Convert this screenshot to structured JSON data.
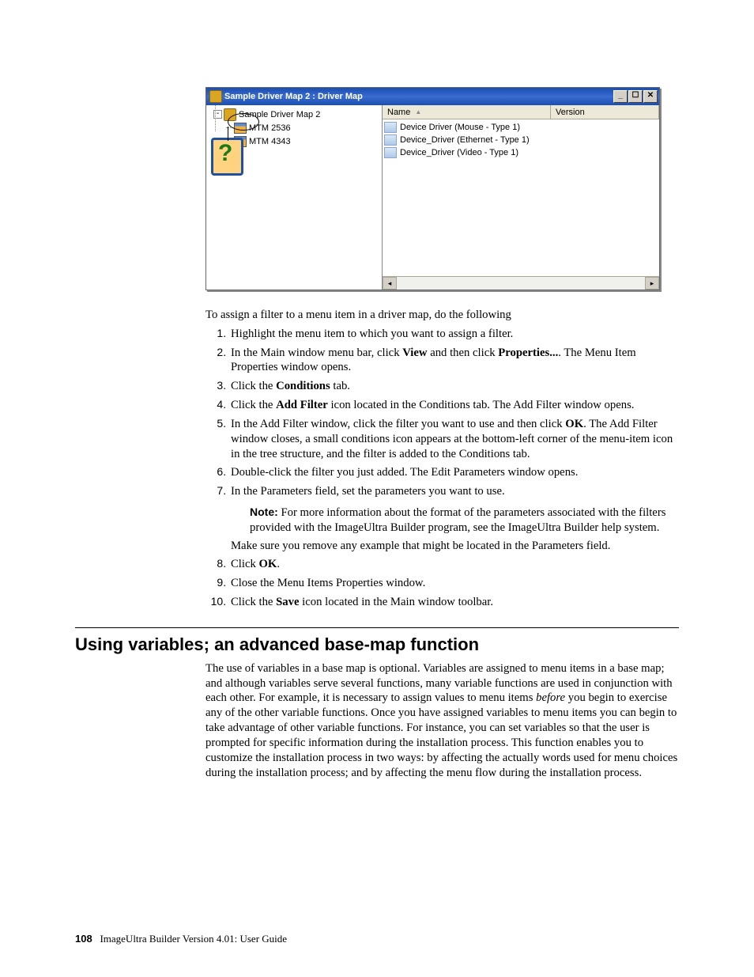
{
  "window": {
    "title": "Sample Driver Map 2 : Driver Map",
    "tree_root": "Sample Driver Map 2",
    "tree_children": [
      "MTM 2536",
      "MTM 4343"
    ],
    "list_cols": {
      "name": "Name",
      "version": "Version"
    },
    "list_items": [
      "Device Driver (Mouse - Type 1)",
      "Device_Driver (Ethernet - Type 1)",
      "Device_Driver (Video - Type 1)"
    ]
  },
  "intro": "To assign a filter to a menu item in a driver map, do the following",
  "steps": [
    "Highlight the menu item to which you want to assign a filter.",
    {
      "pre": "In the Main window menu bar, click ",
      "b1": "View",
      "mid": " and then click ",
      "b2": "Properties...",
      "post": ". The Menu Item Properties window opens."
    },
    {
      "pre": "Click the ",
      "b1": "Conditions",
      "post": " tab."
    },
    {
      "pre": "Click the ",
      "b1": "Add Filter",
      "post": " icon located in the Conditions tab. The Add Filter window opens."
    },
    {
      "pre": "In the Add Filter window, click the filter you want to use and then click ",
      "b1": "OK",
      "post": ". The Add Filter window closes, a small conditions icon appears at the bottom-left corner of the menu-item icon in the tree structure, and the filter is added to the Conditions tab."
    },
    "Double-click the filter you just added. The Edit Parameters window opens.",
    "In the Parameters field, set the parameters you want to use.",
    {
      "pre": "Click ",
      "b1": "OK",
      "post": "."
    },
    "Close the Menu Items Properties window.",
    {
      "pre": "Click the ",
      "b1": "Save",
      "post": " icon located in the Main window toolbar."
    }
  ],
  "note": {
    "label": "Note:",
    "text": "For more information about the format of the parameters associated with the filters provided with the ImageUltra Builder program, see the ImageUltra Builder help system."
  },
  "after_note": "Make sure you remove any example that might be located in the Parameters field.",
  "heading": "Using variables; an advanced base-map function",
  "section": {
    "p1a": "The use of variables in a base map is optional. Variables are assigned to menu items in a base map; and although variables serve several functions, many variable functions are used in conjunction with each other. For example, it is necessary to assign values to menu items ",
    "p1i": "before",
    "p1b": " you begin to exercise any of the other variable functions. Once you have assigned variables to menu items you can begin to take advantage of other variable functions. For instance, you can set variables so that the user is prompted for specific information during the installation process. This function enables you to customize the installation process in two ways: by affecting the actually words used for menu choices during the installation process; and by affecting the menu flow during the installation process."
  },
  "footer": {
    "page": "108",
    "doc": "ImageUltra Builder Version 4.01: User Guide"
  }
}
